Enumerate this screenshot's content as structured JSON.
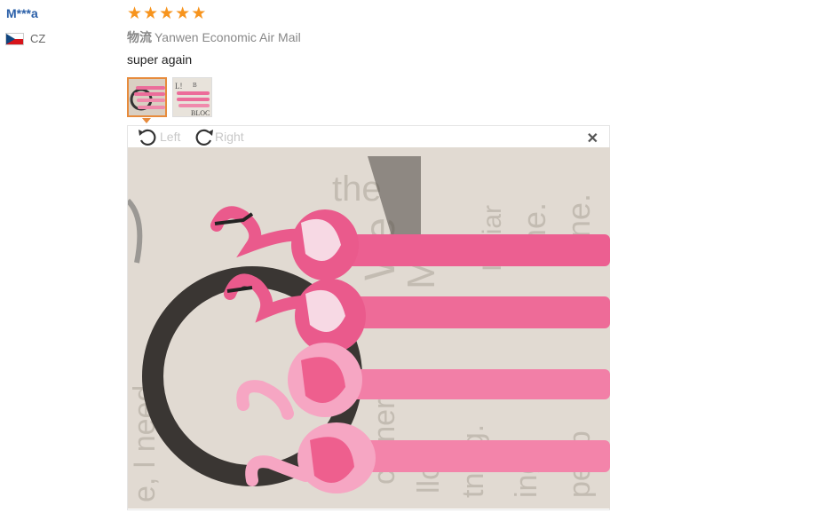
{
  "reviewer": {
    "name": "M***a",
    "country_code": "CZ",
    "flag_colors": [
      "#ffffff",
      "#d7141a",
      "#11457e"
    ]
  },
  "rating": {
    "stars": 5,
    "max": 5,
    "color": "#f7941d"
  },
  "shipping": {
    "label": "物流",
    "method": "Yanwen Economic Air Mail"
  },
  "review": {
    "text": "super again"
  },
  "thumbnails": [
    {
      "icon": "flamingo-pens-photo",
      "selected": true
    },
    {
      "icon": "flamingo-pens-book-photo",
      "selected": false
    }
  ],
  "viewer": {
    "rotate_left_label": "Left",
    "rotate_right_label": "Right",
    "close_symbol": "✕"
  }
}
